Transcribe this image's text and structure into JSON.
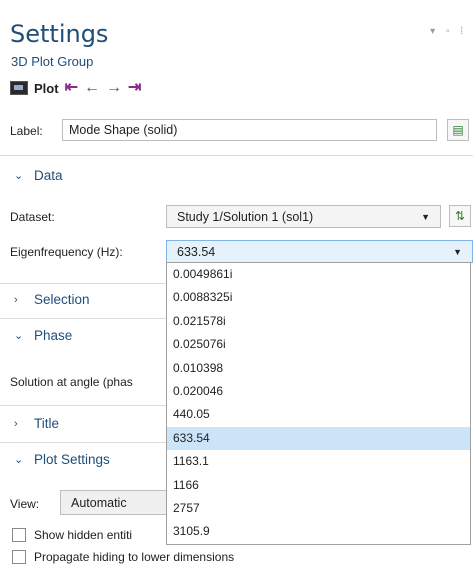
{
  "header": {
    "title": "Settings",
    "subtitle": "3D Plot Group",
    "plot_label": "Plot"
  },
  "label_row": {
    "label": "Label:",
    "value": "Mode Shape (solid)"
  },
  "sections": {
    "data": "Data",
    "selection": "Selection",
    "phase": "Phase",
    "title": "Title",
    "plot_settings": "Plot Settings"
  },
  "data_section": {
    "dataset_label": "Dataset:",
    "dataset_value": "Study 1/Solution 1 (sol1)",
    "eigen_label": "Eigenfrequency (Hz):",
    "eigen_value": "633.54"
  },
  "phase_section": {
    "solution_angle_label": "Solution at angle (phas"
  },
  "plot_settings": {
    "view_label": "View:",
    "view_value": "Automatic",
    "show_hidden_label": "Show hidden entiti",
    "propagate_label": "Propagate hiding to lower dimensions"
  },
  "eigen_options": [
    "0.0049861i",
    "0.0088325i",
    "0.021578i",
    "0.025076i",
    "0.010398",
    "0.020046",
    "440.05",
    "633.54",
    "1163.1",
    "1166",
    "2757",
    "3105.9"
  ],
  "selected_option_index": 7
}
